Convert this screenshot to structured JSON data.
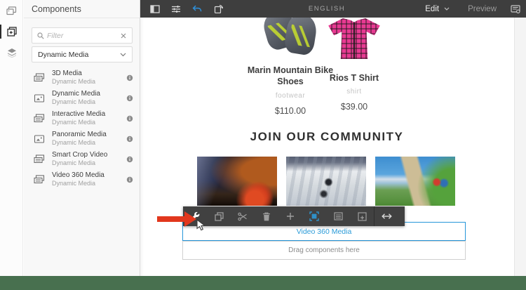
{
  "colors": {
    "topbar_bg": "#3e3e3e",
    "accent_blue": "#2696d9",
    "undo_blue": "#2f8fd8",
    "arrow_red": "#e2371d",
    "footer_green": "#48704f"
  },
  "side_rail": {
    "tabs": [
      {
        "name": "assets",
        "icon": "assets-icon",
        "active": false
      },
      {
        "name": "components",
        "icon": "components-icon",
        "active": true
      },
      {
        "name": "content-tree",
        "icon": "content-tree-icon",
        "active": false
      }
    ]
  },
  "components_panel": {
    "title": "Components",
    "filter": {
      "placeholder": "Filter",
      "value": ""
    },
    "group_dropdown": {
      "value": "Dynamic Media"
    },
    "items": [
      {
        "title": "3D Media",
        "subtitle": "Dynamic Media",
        "icon": "media-stack-icon"
      },
      {
        "title": "Dynamic Media",
        "subtitle": "Dynamic Media",
        "icon": "image-icon"
      },
      {
        "title": "Interactive Media",
        "subtitle": "Dynamic Media",
        "icon": "media-stack-icon"
      },
      {
        "title": "Panoramic Media",
        "subtitle": "Dynamic Media",
        "icon": "image-icon"
      },
      {
        "title": "Smart Crop Video",
        "subtitle": "Dynamic Media",
        "icon": "media-stack-icon"
      },
      {
        "title": "Video 360 Media",
        "subtitle": "Dynamic Media",
        "icon": "media-stack-icon"
      }
    ]
  },
  "top_bar": {
    "page_label": "ENGLISH",
    "edit_label": "Edit",
    "preview_label": "Preview",
    "left_icons": [
      "panel-toggle-icon",
      "properties-icon",
      "undo-icon",
      "device-rotate-icon"
    ],
    "right_icon": "annotations-icon"
  },
  "page": {
    "products": [
      {
        "name": "Marin Mountain Bike Shoes",
        "category": "footwear",
        "price": "$110.00",
        "image": "gray-green-bike-shoes"
      },
      {
        "name": "Rios T Shirt",
        "category": "shirt",
        "price": "$39.00",
        "image": "pink-plaid-shirt"
      }
    ],
    "community": {
      "heading": "JOIN OUR COMMUNITY",
      "photos": [
        "night-campsite-photo",
        "ice-climbing-photo",
        "mountain-bikers-photo"
      ]
    }
  },
  "editor_overlay": {
    "toolbar_icons": [
      "configure-wrench-icon",
      "copy-icon",
      "cut-scissors-icon",
      "delete-trash-icon",
      "insert-plus-icon",
      "dynamic-media-icon",
      "layout-icon",
      "group-icon",
      "resize-width-icon"
    ],
    "selected_component": {
      "label": "Video 360 Media"
    },
    "drop_zone": {
      "label": "Drag components here"
    },
    "annotation": "red-arrow-pointing-at-wrench"
  }
}
